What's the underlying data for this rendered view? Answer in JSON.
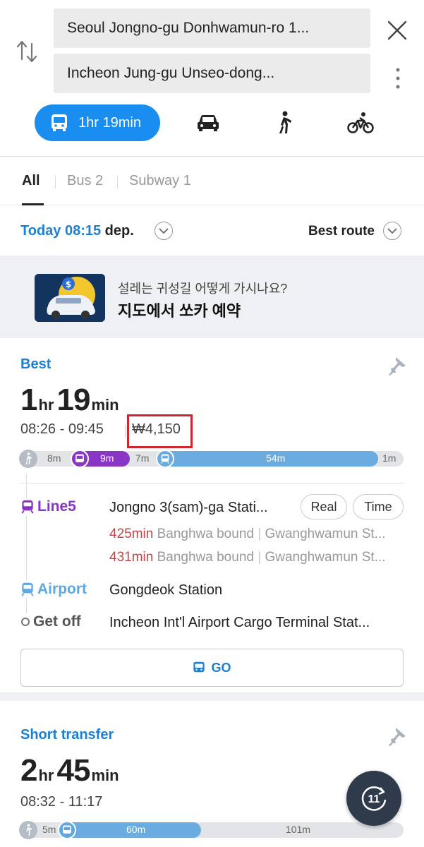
{
  "header": {
    "origin": "Seoul Jongno-gu Donhwamun-ro 1...",
    "destination": "Incheon Jung-gu Unseo-dong...",
    "modes": {
      "transit_time": "1hr 19min"
    }
  },
  "tabs": [
    {
      "label": "All"
    },
    {
      "label": "Bus 2"
    },
    {
      "label": "Subway 1"
    }
  ],
  "departure": {
    "when": "Today 08:15",
    "suffix": " dep.",
    "sort": "Best route"
  },
  "banner": {
    "subtitle": "설레는 귀성길 어떻게 가시나요?",
    "title": "지도에서 쏘카 예약"
  },
  "routes": [
    {
      "label": "Best",
      "hours": "1",
      "hr_unit": "hr",
      "minutes": "19",
      "min_unit": "min",
      "times": "08:26 - 09:45",
      "fare": "₩4,150",
      "segments": [
        {
          "type": "walk",
          "label": "8m"
        },
        {
          "type": "bus",
          "label": "9m"
        },
        {
          "type": "wait",
          "label": "7m"
        },
        {
          "type": "subway",
          "label": "54m"
        },
        {
          "type": "walk",
          "label": "1m"
        }
      ],
      "legs": {
        "line_label": "Line5",
        "board_station": "Jongno 3(sam)-ga Stati...",
        "real_button": "Real",
        "time_button": "Time",
        "arrivals": [
          {
            "mins": "425min",
            "bound": " Banghwa bound",
            "next": "Gwanghwamun St..."
          },
          {
            "mins": "431min",
            "bound": " Banghwa bound",
            "next": "Gwanghwamun St..."
          }
        ],
        "transfer_label": "Airport",
        "transfer_station": "Gongdeok Station",
        "getoff_label": "Get off",
        "getoff_station": "Incheon Int'l Airport Cargo Terminal Stat..."
      },
      "go_label": "GO"
    },
    {
      "label": "Short transfer",
      "hours": "2",
      "hr_unit": "hr",
      "minutes": "45",
      "min_unit": "min",
      "times": "08:32 - 11:17",
      "segments": [
        {
          "type": "walk",
          "label": "5m"
        },
        {
          "type": "bus",
          "label": "60m"
        },
        {
          "type": "subway",
          "label": "101m"
        }
      ]
    }
  ],
  "fab": {
    "label": "11"
  },
  "colors": {
    "accent": "#1a8ef0",
    "line5": "#8a35c6",
    "airport": "#5ea7df",
    "fare_highlight": "#d0262f"
  },
  "icons": [
    "swap-icon",
    "close-icon",
    "more-icon",
    "bus-icon",
    "car-icon",
    "walk-icon",
    "bike-icon",
    "chevron-down-icon",
    "pin-icon",
    "subway-icon",
    "refresh-icon"
  ]
}
